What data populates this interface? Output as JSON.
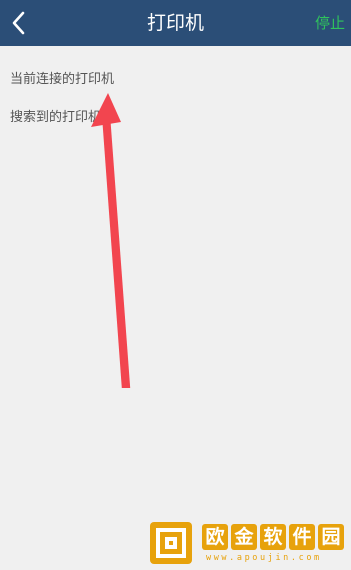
{
  "header": {
    "back_icon": "chevron-left-icon",
    "title": "打印机",
    "stop_label": "停止",
    "bg_color": "#2b4e77",
    "stop_color": "#2fc45c"
  },
  "sections": {
    "connected_label": "当前连接的打印机",
    "found_label": "搜索到的打印机"
  },
  "annotation": {
    "arrow_icon": "red-arrow-icon",
    "arrow_color": "#f2454f"
  },
  "watermark": {
    "logo_icon": "apoujin-logo-icon",
    "chars": [
      "欧",
      "金",
      "软",
      "件",
      "园"
    ],
    "url": "www.apoujin.com",
    "color": "#e7a20c"
  }
}
